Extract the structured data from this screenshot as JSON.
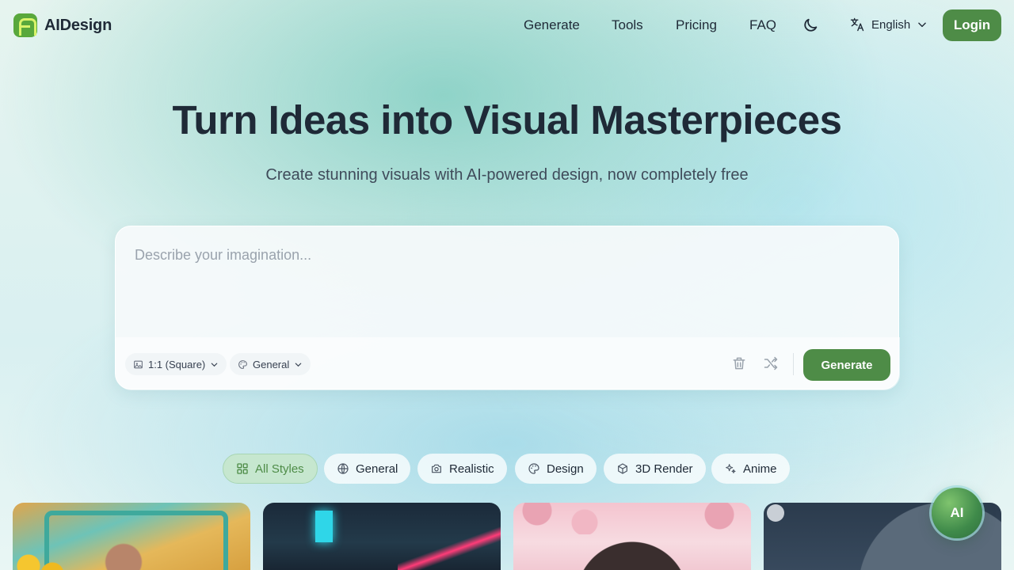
{
  "app": {
    "brand": "AIDesign"
  },
  "header": {
    "nav": [
      "Generate",
      "Tools",
      "Pricing",
      "FAQ"
    ],
    "language": "English",
    "login_label": "Login"
  },
  "hero": {
    "title": "Turn Ideas into Visual Masterpieces",
    "subtitle": "Create stunning visuals with AI-powered design, now completely free"
  },
  "prompt": {
    "placeholder": "Describe your imagination...",
    "aspect_ratio": "1:1 (Square)",
    "style": "General",
    "generate_label": "Generate"
  },
  "style_tabs": [
    {
      "label": "All Styles",
      "icon": "grid-icon",
      "active": true
    },
    {
      "label": "General",
      "icon": "globe-icon",
      "active": false
    },
    {
      "label": "Realistic",
      "icon": "camera-icon",
      "active": false
    },
    {
      "label": "Design",
      "icon": "palette-icon",
      "active": false
    },
    {
      "label": "3D Render",
      "icon": "cube-icon",
      "active": false
    },
    {
      "label": "Anime",
      "icon": "sparkles-icon",
      "active": false
    }
  ],
  "assistant": {
    "label": "AI"
  },
  "colors": {
    "accent": "#4e8c47",
    "active_tab_bg": "#c6e7cf",
    "text": "#1f2a37"
  }
}
